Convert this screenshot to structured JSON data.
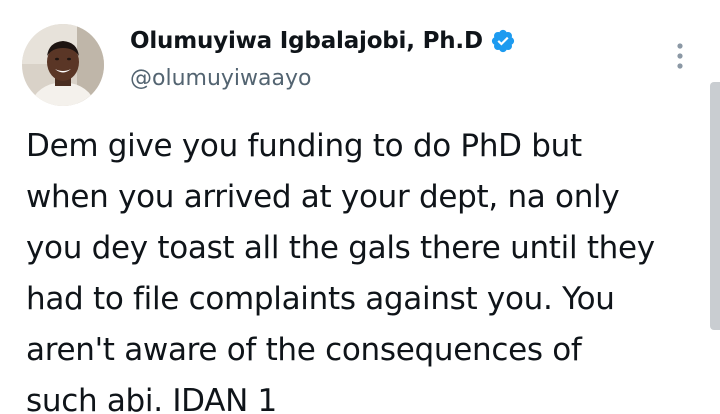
{
  "author": {
    "display_name": "Olumuyiwa Igbalajobi, Ph.D",
    "handle": "@olumuyiwaayo",
    "verified_icon": "verified-badge-icon",
    "avatar_icon": "profile-photo"
  },
  "menu": {
    "icon": "more-options-icon"
  },
  "tweet": {
    "lines": [
      "Dem give you funding to do PhD but",
      "when you arrived at your dept, na only",
      "you dey toast all the gals there until they",
      "had to file complaints against you. You",
      "aren't aware of the consequences of",
      "such abi. IDAN 1"
    ]
  },
  "colors": {
    "text": "#0f1419",
    "secondary_text": "#536471",
    "verified_blue": "#1d9bf0",
    "scrollbar": "#c9cdd1"
  }
}
